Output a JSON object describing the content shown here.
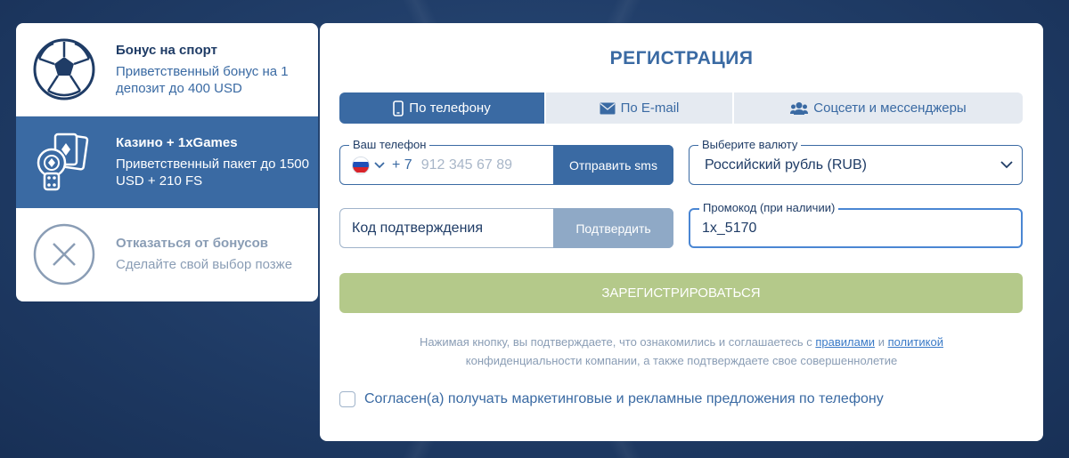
{
  "bonuses": [
    {
      "title": "Бонус на спорт",
      "desc": "Приветственный бонус на 1 депозит до 400 USD",
      "icon": "soccer-ball-icon",
      "state": "normal"
    },
    {
      "title": "Казино + 1xGames",
      "desc": "Приветственный пакет до 1500 USD + 210 FS",
      "icon": "casino-cards-chip-dice-icon",
      "state": "active"
    },
    {
      "title": "Отказаться от бонусов",
      "desc": "Сделайте свой выбор позже",
      "icon": "close-circle-icon",
      "state": "muted"
    }
  ],
  "registration": {
    "title": "РЕГИСТРАЦИЯ",
    "tabs": [
      {
        "label": "По телефону",
        "icon": "phone-icon",
        "active": true
      },
      {
        "label": "По E-mail",
        "icon": "envelope-icon",
        "active": false
      },
      {
        "label": "Соцсети и мессенджеры",
        "icon": "users-icon",
        "active": false
      }
    ],
    "phone": {
      "label": "Ваш телефон",
      "country_code": "+ 7",
      "placeholder": "912 345 67 89",
      "value": "",
      "send_sms_label": "Отправить sms"
    },
    "currency": {
      "label": "Выберите валюту",
      "value": "Российский рубль (RUB)"
    },
    "code": {
      "placeholder": "Код подтверждения",
      "confirm_label": "Подтвердить"
    },
    "promo": {
      "label": "Промокод (при наличии)",
      "value": "1x_5170"
    },
    "register_label": "ЗАРЕГИСТРИРОВАТЬСЯ",
    "legal": {
      "part1": "Нажимая кнопку, вы подтверждаете, что ознакомились и соглашаетесь с ",
      "rules_link": "правилами",
      "and": " и ",
      "policy_link": "политикой",
      "part2": "конфиденциальности компании, а также подтверждаете свое совершеннолетие"
    },
    "consent_label": "Согласен(а) получать маркетинговые и рекламные предложения по телефону",
    "consent_checked": false
  },
  "colors": {
    "primary": "#3a6aa3",
    "dark": "#1f3c66",
    "register_button": "#b4c98a",
    "confirm_button": "#8fa9c6",
    "link": "#3a7ac7"
  }
}
